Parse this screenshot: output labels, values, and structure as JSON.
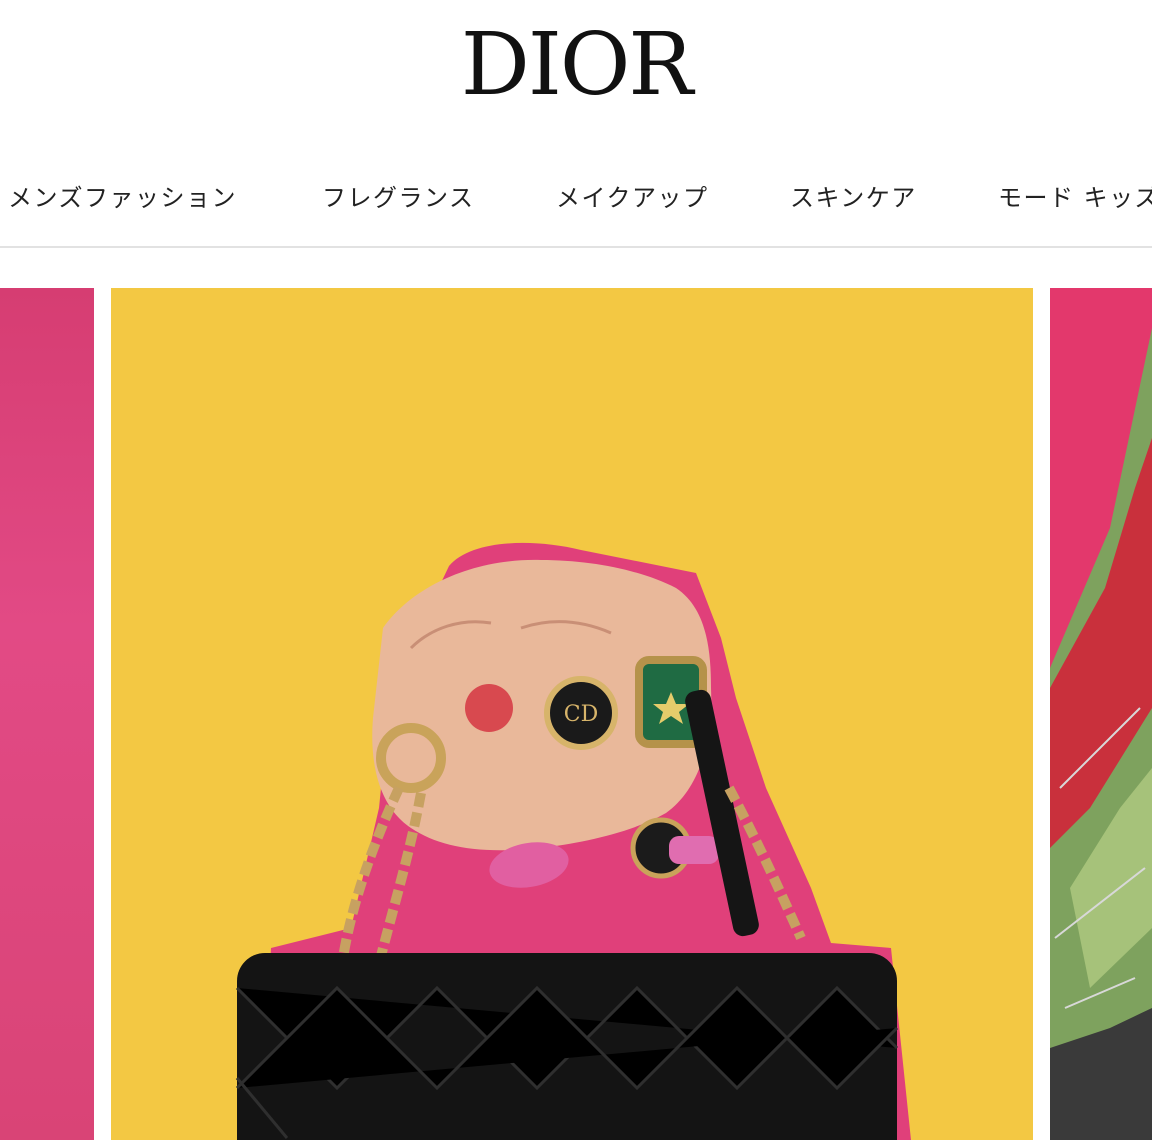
{
  "header": {
    "logo_text": "DIOR"
  },
  "nav": {
    "items": [
      {
        "label": "メンズファッション"
      },
      {
        "label": "フレグランス"
      },
      {
        "label": "メイクアップ"
      },
      {
        "label": "スキンケア"
      },
      {
        "label": "モード キッズ"
      }
    ]
  },
  "hero": {
    "slides": [
      {
        "description_icon": "pink-campaign-image-partial"
      },
      {
        "description_icon": "bag-with-rings-image"
      },
      {
        "description_icon": "metallic-outfit-image-partial"
      }
    ]
  },
  "colors": {
    "yellow_bg": "#f3c843",
    "pink_bg": "#e3386c",
    "nav_divider": "#e2e2e2"
  }
}
